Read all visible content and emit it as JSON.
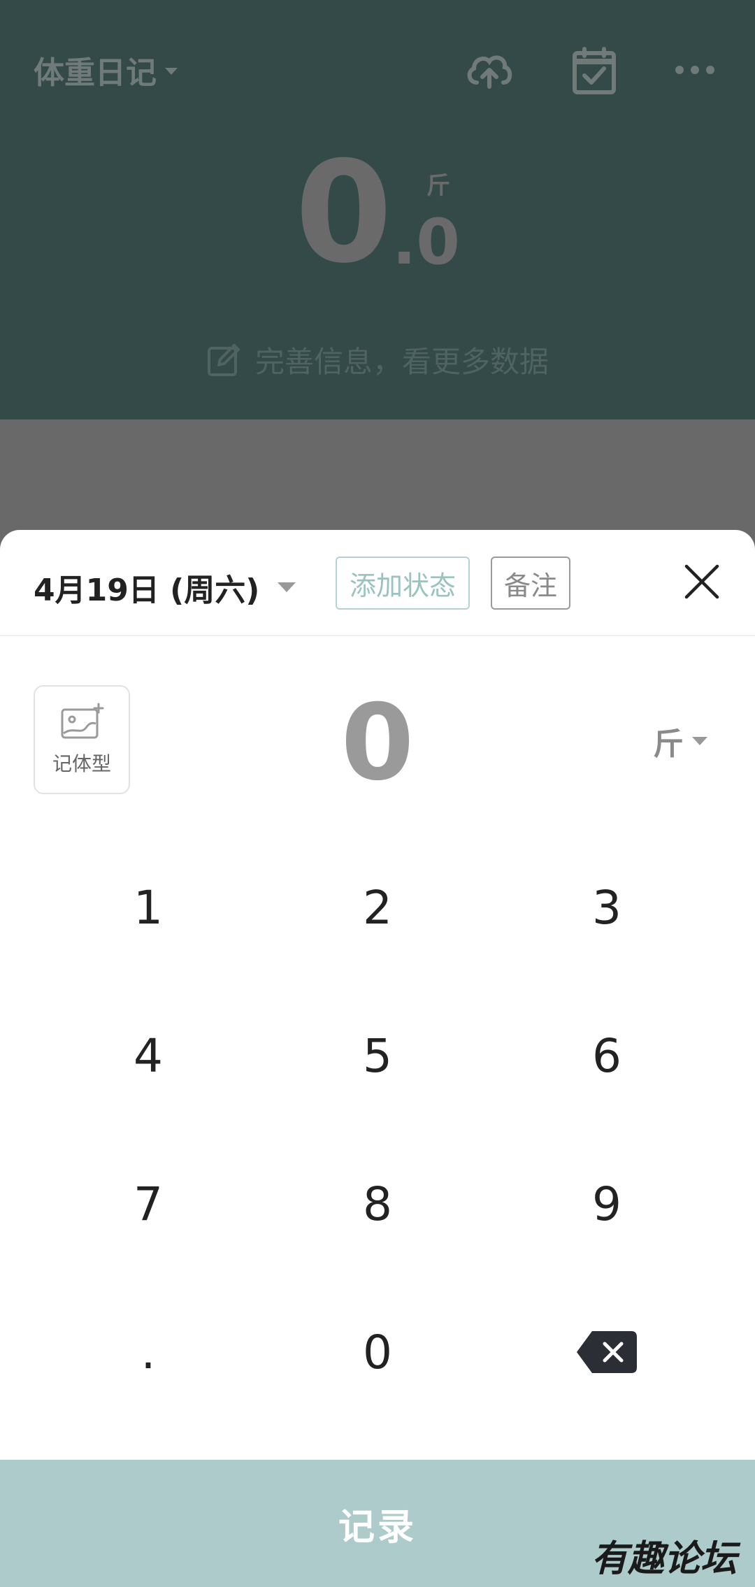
{
  "background": {
    "app_title": "体重日记",
    "weight_integer": "0",
    "weight_dot": ".",
    "weight_decimal": "0",
    "weight_unit": "斤",
    "info_prompt": "完善信息，看更多数据"
  },
  "sheet": {
    "date_label": "4月19日 (周六)",
    "add_status_label": "添加状态",
    "note_label": "备注",
    "body_type_label": "记体型",
    "current_value": "0",
    "unit": "斤",
    "keys": [
      "1",
      "2",
      "3",
      "4",
      "5",
      "6",
      "7",
      "8",
      "9",
      ".",
      "0"
    ],
    "record_label": "记录"
  },
  "watermark": "有趣论坛",
  "colors": {
    "header_bg": "#334a48",
    "accent": "#adcbca",
    "status_chip": "#9ac3bf"
  }
}
